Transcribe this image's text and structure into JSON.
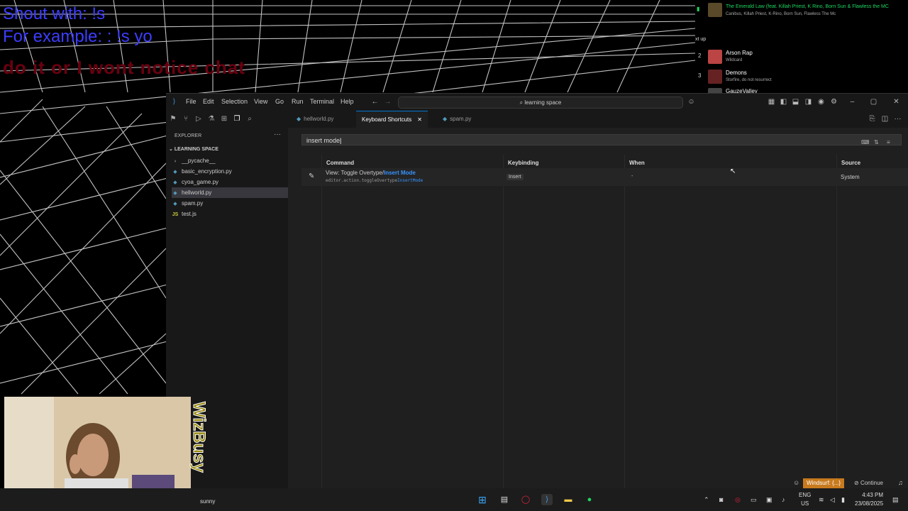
{
  "overlay": {
    "line1": "Shout with: !s",
    "line2": "For example: : !s yo",
    "line3": "do it or I wont notice chat"
  },
  "spotify": {
    "now_title": "The Emerald Law (feat. Killah Priest, K Rino, Born Sun & Flawless the MC",
    "now_artist": "Canibus, Killah Priest, K-Rino, Born Sun, Flawless The Mc",
    "next_label": "xt up",
    "queue": [
      {
        "num": "2",
        "title": "Arson Rap",
        "artist": "Wildcard"
      },
      {
        "num": "3",
        "title": "Demons",
        "artist": "Storfire, do not resurrect"
      },
      {
        "num": "",
        "title": "GauzeValley",
        "artist": ""
      }
    ]
  },
  "vscode": {
    "menu": [
      "File",
      "Edit",
      "Selection",
      "View",
      "Go",
      "Run",
      "Terminal",
      "Help"
    ],
    "command_center": "learning space",
    "explorer_label": "EXPLORER",
    "project": "LEARNING SPACE",
    "files": [
      {
        "name": "__pycache__",
        "icon": ">",
        "selected": false
      },
      {
        "name": "basic_encryption.py",
        "icon": "py",
        "selected": false
      },
      {
        "name": "cyoa_game.py",
        "icon": "py",
        "selected": false
      },
      {
        "name": "hellworld.py",
        "icon": "py",
        "selected": true
      },
      {
        "name": "spam.py",
        "icon": "py",
        "selected": false
      },
      {
        "name": "test.js",
        "icon": "JS",
        "selected": false
      }
    ],
    "tabs": [
      {
        "label": "hellworld.py",
        "active": false
      },
      {
        "label": "Keyboard Shortcuts",
        "active": true
      },
      {
        "label": "spam.py",
        "active": false
      }
    ],
    "search_value": "insert mode",
    "columns": {
      "command": "Command",
      "keybinding": "Keybinding",
      "when": "When",
      "source": "Source"
    },
    "row": {
      "title_prefix": "View: Toggle Overtype/",
      "title_highlight": "Insert Mode",
      "id_prefix": "editor.action.toggleOvertype",
      "id_highlight": "InsertMode",
      "keybinding": "Insert",
      "when": "-",
      "source": "System"
    },
    "status_windsurf": "Windsurf: {...}",
    "status_continue": "Continue"
  },
  "webcam": {
    "label": "WizBusy"
  },
  "taskbar": {
    "left_text": "sunny",
    "lang1": "ENG",
    "lang2": "US",
    "time": "4:43 PM",
    "date": "23/08/2025"
  }
}
